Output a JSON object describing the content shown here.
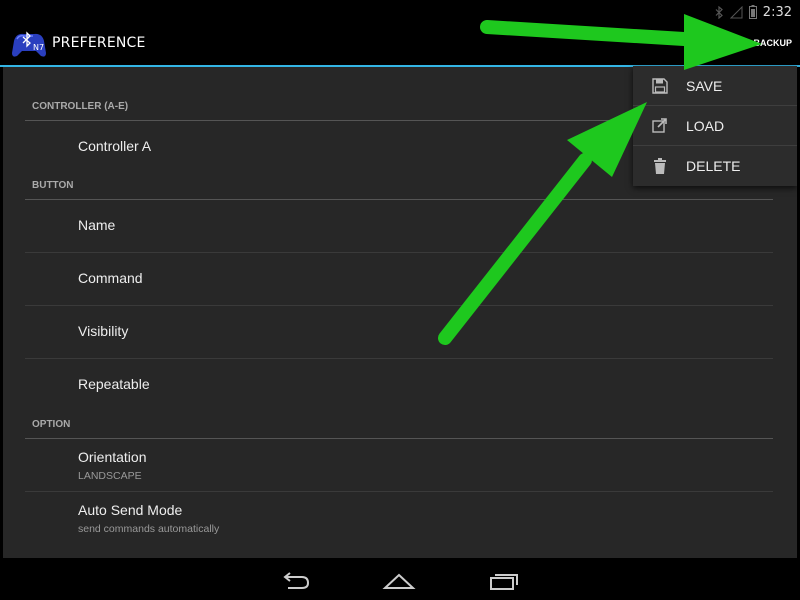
{
  "status_bar": {
    "time": "2:32",
    "icons": [
      "bluetooth-icon",
      "signal-icon",
      "battery-icon"
    ]
  },
  "action_bar": {
    "title": "PREFERENCE",
    "overflow_button": "BACKUP",
    "accent_color": "#33b5e5"
  },
  "preferences": {
    "sections": [
      {
        "header": "CONTROLLER (A-E)",
        "items": [
          {
            "title": "Controller A",
            "summary": ""
          }
        ]
      },
      {
        "header": "BUTTON",
        "items": [
          {
            "title": "Name",
            "summary": ""
          },
          {
            "title": "Command",
            "summary": ""
          },
          {
            "title": "Visibility",
            "summary": ""
          },
          {
            "title": "Repeatable",
            "summary": ""
          }
        ]
      },
      {
        "header": "OPTION",
        "items": [
          {
            "title": "Orientation",
            "summary": "LANDSCAPE"
          },
          {
            "title": "Auto Send Mode",
            "summary": "send commands automatically"
          }
        ]
      }
    ]
  },
  "backup_menu": {
    "items": [
      {
        "label": "SAVE",
        "icon": "save-icon"
      },
      {
        "label": "LOAD",
        "icon": "load-icon"
      },
      {
        "label": "DELETE",
        "icon": "trash-icon"
      }
    ]
  },
  "nav_bar": {
    "buttons": [
      "back-icon",
      "home-icon",
      "recents-icon"
    ]
  },
  "annotation_color": "#1ec81e"
}
